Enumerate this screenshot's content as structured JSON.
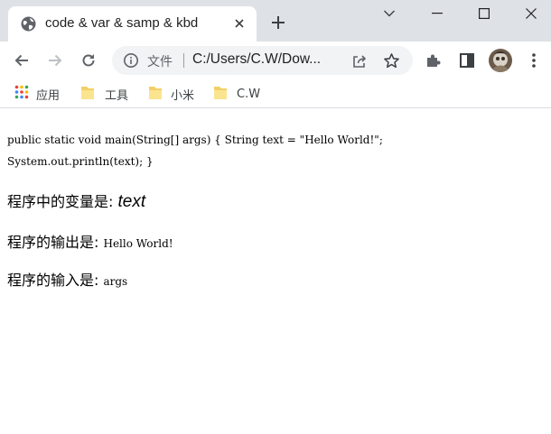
{
  "browser": {
    "tab": {
      "title": "code & var & samp & kbd"
    },
    "address_bar": {
      "scheme_label": "文件",
      "url": "C:/Users/C.W/Dow..."
    },
    "bookmarks": [
      {
        "label": "应用",
        "icon": "apps-grid-icon"
      },
      {
        "label": "工具",
        "icon": "folder-icon"
      },
      {
        "label": "小米",
        "icon": "folder-icon"
      },
      {
        "label": "C.W",
        "icon": "folder-icon"
      }
    ],
    "colors": {
      "tabstrip": "#dee1e6",
      "omnibox": "#f1f3f4",
      "folder": "#f2d067"
    }
  },
  "page": {
    "code_line_1": "public static void main(String[] args) { String text = \"Hello World!\";",
    "code_line_2": "System.out.println(text); }",
    "var_prefix": "程序中的变量是: ",
    "var_value": "text",
    "samp_prefix": "程序的输出是: ",
    "samp_value": "Hello World!",
    "kbd_prefix": "程序的输入是: ",
    "kbd_value": "args"
  }
}
